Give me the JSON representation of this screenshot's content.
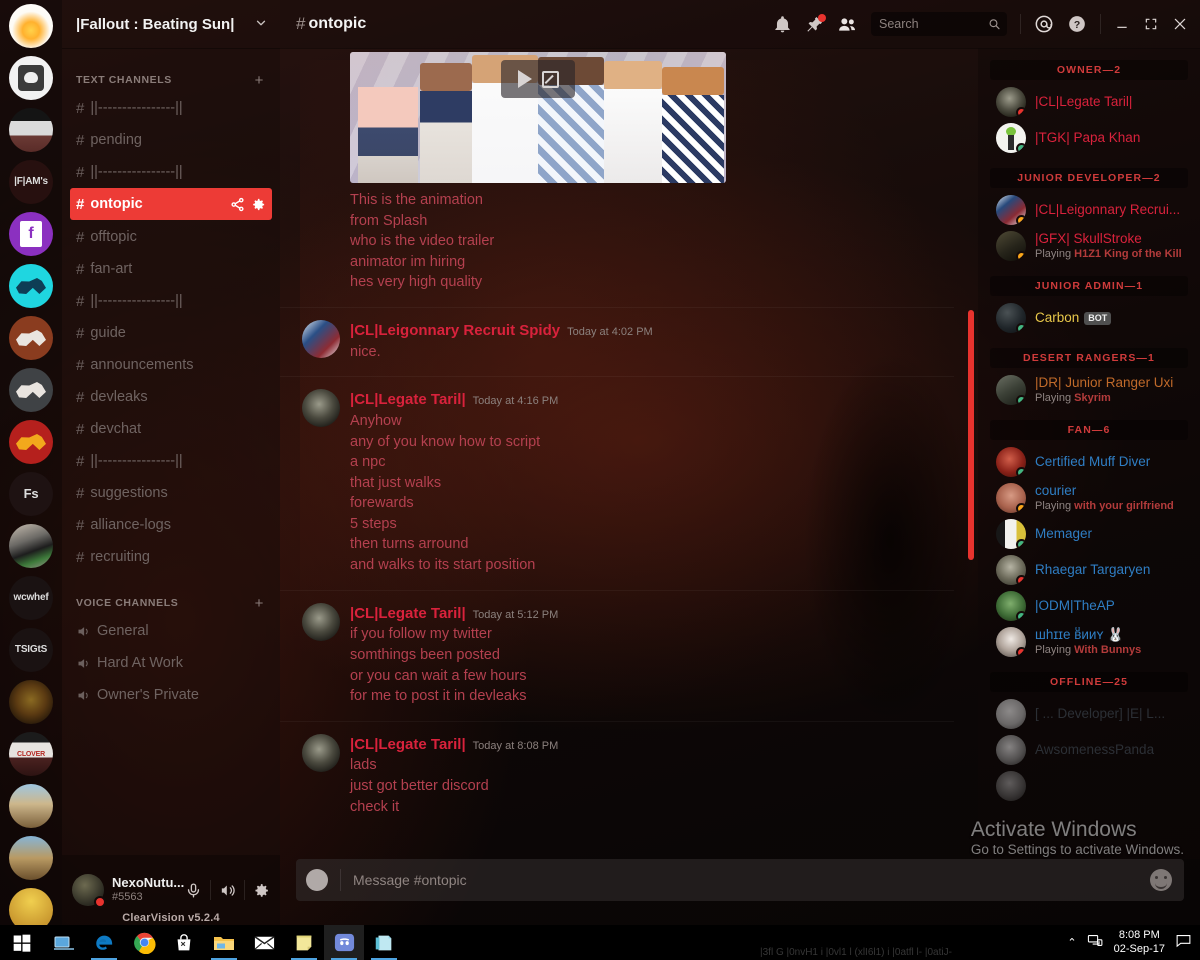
{
  "window": {
    "app": "Discord",
    "theme_name": "ClearVision v5.2.4"
  },
  "guild_rail": {
    "items": [
      {
        "label": "",
        "name": "guild-juice"
      },
      {
        "label": "",
        "name": "guild-skull"
      },
      {
        "label": "",
        "name": "guild-stripe"
      },
      {
        "label": "|F|AM's",
        "name": "guild-fam"
      },
      {
        "label": "",
        "name": "guild-fortnite"
      },
      {
        "label": "",
        "name": "guild-cyan-horse"
      },
      {
        "label": "",
        "name": "guild-brown-horse"
      },
      {
        "label": "",
        "name": "guild-grey-horse"
      },
      {
        "label": "",
        "name": "guild-red-horse"
      },
      {
        "label": "Fs",
        "name": "guild-fs"
      },
      {
        "label": "",
        "name": "guild-gun"
      },
      {
        "label": "wcwhef",
        "name": "guild-wcwhef"
      },
      {
        "label": "TSIGtS",
        "name": "guild-tsigts"
      },
      {
        "label": "",
        "name": "guild-emblem"
      },
      {
        "label": "CLOVER",
        "name": "guild-clover"
      },
      {
        "label": "",
        "name": "guild-runner"
      },
      {
        "label": "",
        "name": "guild-mater"
      }
    ]
  },
  "sidebar": {
    "server_name": "|Fallout : Beating Sun|",
    "chevron": "⌄",
    "text_channels_header": "TEXT CHANNELS",
    "voice_channels_header": "VOICE CHANNELS",
    "add_icon": "+",
    "text_channels": [
      {
        "name": "||----------------||",
        "active": false
      },
      {
        "name": "pending",
        "active": false
      },
      {
        "name": "||----------------||",
        "active": false
      },
      {
        "name": "ontopic",
        "active": true
      },
      {
        "name": "offtopic",
        "active": false
      },
      {
        "name": "fan-art",
        "active": false
      },
      {
        "name": "||----------------||",
        "active": false
      },
      {
        "name": "guide",
        "active": false
      },
      {
        "name": "announcements",
        "active": false
      },
      {
        "name": "devleaks",
        "active": false
      },
      {
        "name": "devchat",
        "active": false
      },
      {
        "name": "||----------------||",
        "active": false
      },
      {
        "name": "suggestions",
        "active": false
      },
      {
        "name": "alliance-logs",
        "active": false
      },
      {
        "name": "recruiting",
        "active": false
      }
    ],
    "voice_channels": [
      {
        "name": "General"
      },
      {
        "name": "Hard At Work"
      },
      {
        "name": "Owner's Private"
      }
    ]
  },
  "user_panel": {
    "username": "NexoNutu...",
    "discriminator": "#5563",
    "status": "dnd",
    "theme_label": "ClearVision v5.2.4",
    "mic_icon": "microphone-icon",
    "deafen_icon": "headphones-icon",
    "settings_icon": "gear-icon"
  },
  "topbar": {
    "hash": "#",
    "channel": "ontopic",
    "icons": [
      "bell-icon",
      "pin-icon",
      "members-icon",
      "mention-icon",
      "help-icon"
    ],
    "search": {
      "placeholder": "Search",
      "value": ""
    },
    "window_controls": [
      "minimize",
      "maximize",
      "close"
    ]
  },
  "chat": {
    "embed": {
      "type": "video-embed",
      "play_label": "play-icon",
      "popout_label": "popout-icon"
    },
    "messages": [
      {
        "continuation": true,
        "author": "",
        "timestamp": "",
        "lines": [
          "This is the animation",
          "from Splash",
          "who is the video trailer",
          "animator im hiring",
          "hes very high quality"
        ]
      },
      {
        "continuation": false,
        "author": "|CL|Leigonnary Recruit Spidy",
        "timestamp": "Today at 4:02 PM",
        "avatar": "av-spidy",
        "lines": [
          "nice."
        ]
      },
      {
        "continuation": false,
        "author": "|CL|Legate Taril|",
        "timestamp": "Today at 4:16 PM",
        "avatar": "av-taril",
        "lines": [
          "Anyhow",
          "any of you know how to script",
          "a npc",
          "that just walks",
          "forewards",
          "5 steps",
          "then turns arround",
          "and walks to its start position"
        ]
      },
      {
        "continuation": false,
        "author": "|CL|Legate Taril|",
        "timestamp": "Today at 5:12 PM",
        "avatar": "av-taril",
        "lines": [
          "if you follow my twitter",
          "somthings been posted",
          "or you can wait a few hours",
          "for me to post it in devleaks"
        ]
      },
      {
        "continuation": false,
        "author": "|CL|Legate Taril|",
        "timestamp": "Today at 8:08 PM",
        "avatar": "av-taril",
        "lines": [
          "lads",
          "just got better discord",
          "check it"
        ]
      }
    ]
  },
  "composer": {
    "placeholder": "Message #ontopic",
    "value": "",
    "attach_icon": "plus-icon",
    "emoji_icon": "emoji-icon"
  },
  "members": {
    "groups": [
      {
        "title": "OWNER—2",
        "role": "owner",
        "people": [
          {
            "name": "|CL|Legate Taril|",
            "status": "dnd",
            "game": "",
            "avatar_class": "av-m-taril"
          },
          {
            "name": "|TGK| Papa Khan",
            "status": "online",
            "game": "",
            "avatar_class": "av-m-khan"
          }
        ]
      },
      {
        "title": "JUNIOR DEVELOPER—2",
        "role": "jdev",
        "people": [
          {
            "name": "|CL|Leigonnary Recrui...",
            "status": "idle",
            "game": "",
            "avatar_class": "av-m-spidy"
          },
          {
            "name": "|GFX| SkullStroke",
            "status": "idle",
            "game_prefix": "Playing ",
            "game": "H1Z1 King of the Kill",
            "avatar_class": "av-m-skull"
          }
        ]
      },
      {
        "title": "JUNIOR ADMIN—1",
        "role": "bot",
        "people": [
          {
            "name": "Carbon",
            "badge": "BOT",
            "status": "online",
            "game": "",
            "avatar_class": "av-m-carbon"
          }
        ]
      },
      {
        "title": "DESERT RANGERS—1",
        "role": "ranger",
        "people": [
          {
            "name": "|DR| Junior Ranger Uxi",
            "status": "online",
            "game_prefix": "Playing ",
            "game": "Skyrim",
            "avatar_class": "av-m-uxi"
          }
        ]
      },
      {
        "title": "FAN—6",
        "role": "fan",
        "people": [
          {
            "name": "Certified Muff Diver",
            "status": "online",
            "game": "",
            "avatar_class": "av-m-muff"
          },
          {
            "name": "courier",
            "status": "idle",
            "game_prefix": "Playing ",
            "game": "with your girlfriend",
            "avatar_class": "av-m-courier"
          },
          {
            "name": "Memager",
            "status": "online",
            "game": "",
            "avatar_class": "av-m-memager"
          },
          {
            "name": "Rhaegar Targaryen",
            "status": "dnd",
            "game": "",
            "avatar_class": "av-m-rhaegar"
          },
          {
            "name": "|ODM|TheAP",
            "status": "online",
            "game": "",
            "avatar_class": "av-m-odm"
          },
          {
            "name": "шһɪɪe ʙͩииʏ 🐰",
            "status": "dnd",
            "game_prefix": "Playing ",
            "game": "With Bunnys",
            "avatar_class": "av-m-bunny"
          }
        ]
      },
      {
        "title": "OFFLINE—25",
        "role": "offline",
        "people": [
          {
            "name": "[ ... Developer] |E| L...",
            "status": "offline",
            "game": "",
            "avatar_class": "av-m-off1"
          },
          {
            "name": "AwsomenessPanda",
            "status": "offline",
            "game": "",
            "avatar_class": "av-m-off2"
          }
        ]
      }
    ]
  },
  "watermark": {
    "line1": "Activate Windows",
    "line2": "Go to Settings to activate Windows."
  },
  "taskbar": {
    "start_icon": "windows-start-icon",
    "items": [
      {
        "name": "task-view-icon",
        "active": false
      },
      {
        "name": "edge-icon",
        "active": false
      },
      {
        "name": "chrome-icon",
        "active": false
      },
      {
        "name": "store-icon",
        "active": false
      },
      {
        "name": "file-explorer-icon",
        "active": false
      },
      {
        "name": "mail-icon",
        "active": false
      },
      {
        "name": "sticky-notes-icon",
        "active": false
      },
      {
        "name": "discord-icon",
        "active": true
      },
      {
        "name": "onenote-icon",
        "active": false
      }
    ],
    "tray": {
      "chevron": "⌃",
      "network_icon": "network-icon",
      "time": "8:08 PM",
      "date": "02-Sep-17",
      "action_center_icon": "action-center-icon",
      "ghost_text": "|3fl G |0nvH1 i |0vl1 l (xlI6l1) i |0atfl l- |0atiJ-"
    }
  },
  "colors": {
    "accent_red": "#ed3b36",
    "author_red": "#d9223c",
    "message_text": "#b4404f",
    "member_header": "#cf3b3b",
    "fan_blue": "#2f7ec4",
    "bot_yellow": "#e8c84a",
    "online_green": "#43b581",
    "idle_orange": "#faa61a",
    "dnd_red": "#e8332e"
  }
}
